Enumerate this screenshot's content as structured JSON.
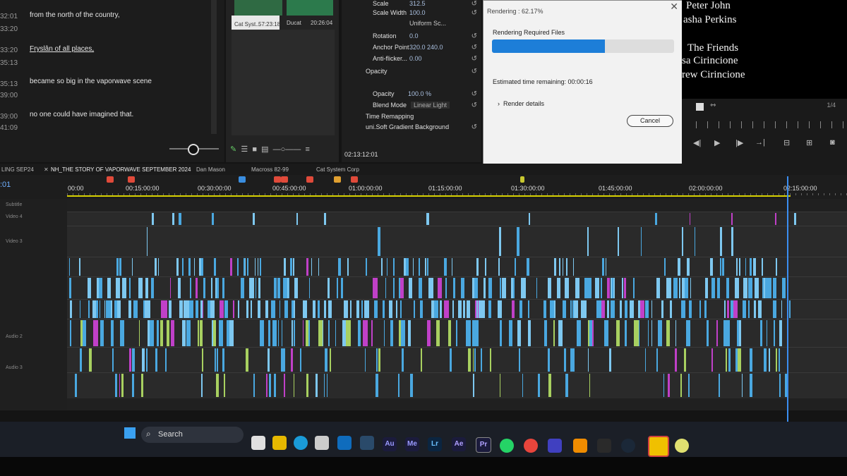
{
  "transcript": {
    "rows": [
      {
        "tc_start": "32:01",
        "tc_end": "33:20",
        "text": "from the north of the country,"
      },
      {
        "tc_start": "33:20",
        "tc_end": "35:13",
        "text": "Fryslân of all places,"
      },
      {
        "tc_start": "35:13",
        "tc_end": "39:00",
        "text": "became so big in the vaporwave scene"
      },
      {
        "tc_start": "39:00",
        "tc_end": "41:09",
        "text": "no one could have imagined that."
      }
    ]
  },
  "bins": {
    "clips": [
      {
        "name": "Cat Syst...",
        "duration": "57:23:18"
      },
      {
        "name": "Ducat",
        "duration": "20:26:04"
      }
    ]
  },
  "effects": {
    "rows": [
      {
        "label": "Scale",
        "value": "312.5"
      },
      {
        "label": "Scale Width",
        "value": "100.0"
      },
      {
        "label": "Uniform Sc...",
        "value": ""
      },
      {
        "label": "Rotation",
        "value": "0.0"
      },
      {
        "label": "Anchor Point",
        "value": "320.0      240.0"
      },
      {
        "label": "Anti-flicker...",
        "value": "0.00"
      },
      {
        "label": "Opacity",
        "value": ""
      },
      {
        "label": "Opacity",
        "value": "100.0 %"
      },
      {
        "label": "Blend Mode",
        "value": "Linear Light"
      },
      {
        "label": "Time Remapping",
        "value": ""
      },
      {
        "label": "uni.Soft Gradient Background",
        "value": ""
      }
    ],
    "timecode": "02:13:12:01"
  },
  "render_dialog": {
    "title": "Rendering : 62.17%",
    "heading": "Rendering Required Files",
    "progress": 0.6217,
    "remaining": "Estimated time remaining: 00:00:16",
    "details": "Render details",
    "cancel": "Cancel"
  },
  "program": {
    "credits": [
      "Peter John",
      "asha Perkins",
      "The Friends",
      "sa Cirincione",
      "rew Cirincione"
    ],
    "page": "1/4"
  },
  "timeline": {
    "tabs": [
      "LING SEP24",
      "NH_THE STORY OF VAPORWAVE SEPTEMBER 2024",
      "Dan Mason",
      "Macross 82-99",
      "Cat System Corp"
    ],
    "current_time": ":01",
    "ruler": [
      "00:00",
      "00:15:00:00",
      "00:30:00:00",
      "00:45:00:00",
      "01:00:00:00",
      "01:15:00:00",
      "01:30:00:00",
      "01:45:00:00",
      "02:00:00:00",
      "02:15:00:00"
    ],
    "tracks": [
      "Subtitle",
      "Video 4",
      "Video 3",
      "Audio 2",
      "Audio 3"
    ],
    "colors": {
      "video": "#4aa8e0",
      "magenta": "#c040c8",
      "audio_green": "#a8d060",
      "playhead": "#3b8ef0",
      "work_area": "#d6d000"
    }
  },
  "taskbar": {
    "search_label": "Search",
    "apps": [
      "Au",
      "Me",
      "Lr",
      "Ae",
      "Pr"
    ]
  }
}
